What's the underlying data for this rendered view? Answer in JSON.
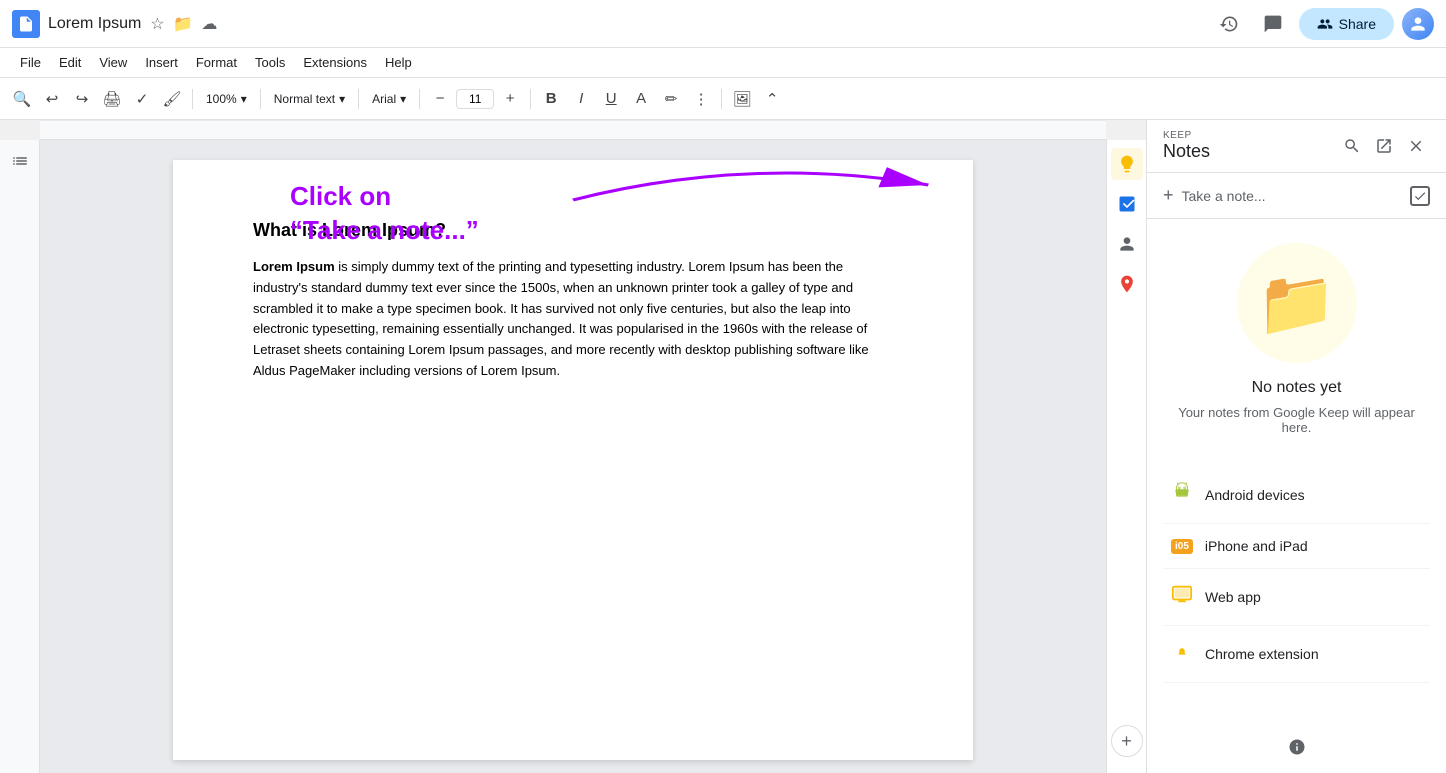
{
  "titleBar": {
    "docTitle": "Lorem Ipsum",
    "starIcon": "⭐",
    "cloudIcon": "☁",
    "driveIcon": "🔒",
    "historyLabel": "Version history",
    "commentLabel": "Comments",
    "shareLabel": "Share",
    "shareIcon": "👤"
  },
  "menuBar": {
    "items": [
      "File",
      "Edit",
      "View",
      "Insert",
      "Format",
      "Tools",
      "Extensions",
      "Help"
    ]
  },
  "toolbar": {
    "zoom": "100%",
    "textStyle": "Normal text",
    "font": "Arial",
    "fontSize": "11",
    "boldLabel": "B",
    "italicLabel": "I",
    "underlineLabel": "U"
  },
  "document": {
    "heading": "What is Lorem Ipsum?",
    "paragraph": " is simply dummy text of the printing and typesetting industry. Lorem Ipsum has been the industry's standard dummy text ever since the 1500s, when an unknown printer took a galley of type and scrambled it to make a type specimen book. It has survived not only five centuries, but also the leap into electronic typesetting, remaining essentially unchanged. It was popularised in the 1960s with the release of Letraset sheets containing Lorem Ipsum passages, and more recently with desktop publishing software like Aldus PageMaker including versions of Lorem Ipsum.",
    "boldStart": "Lorem Ipsum"
  },
  "annotation": {
    "line1": "Click on",
    "line2": "“Take a note...”"
  },
  "keepPanel": {
    "label": "KEEP",
    "title": "Notes",
    "takeNoteText": "Take a note...",
    "noNotesTitle": "No notes yet",
    "noNotesSub": "Your notes from Google Keep will appear here.",
    "links": [
      {
        "icon": "android",
        "label": "Android devices"
      },
      {
        "icon": "ios",
        "label": "iPhone and iPad"
      },
      {
        "icon": "web",
        "label": "Web app"
      },
      {
        "icon": "extension",
        "label": "Chrome extension"
      }
    ]
  }
}
